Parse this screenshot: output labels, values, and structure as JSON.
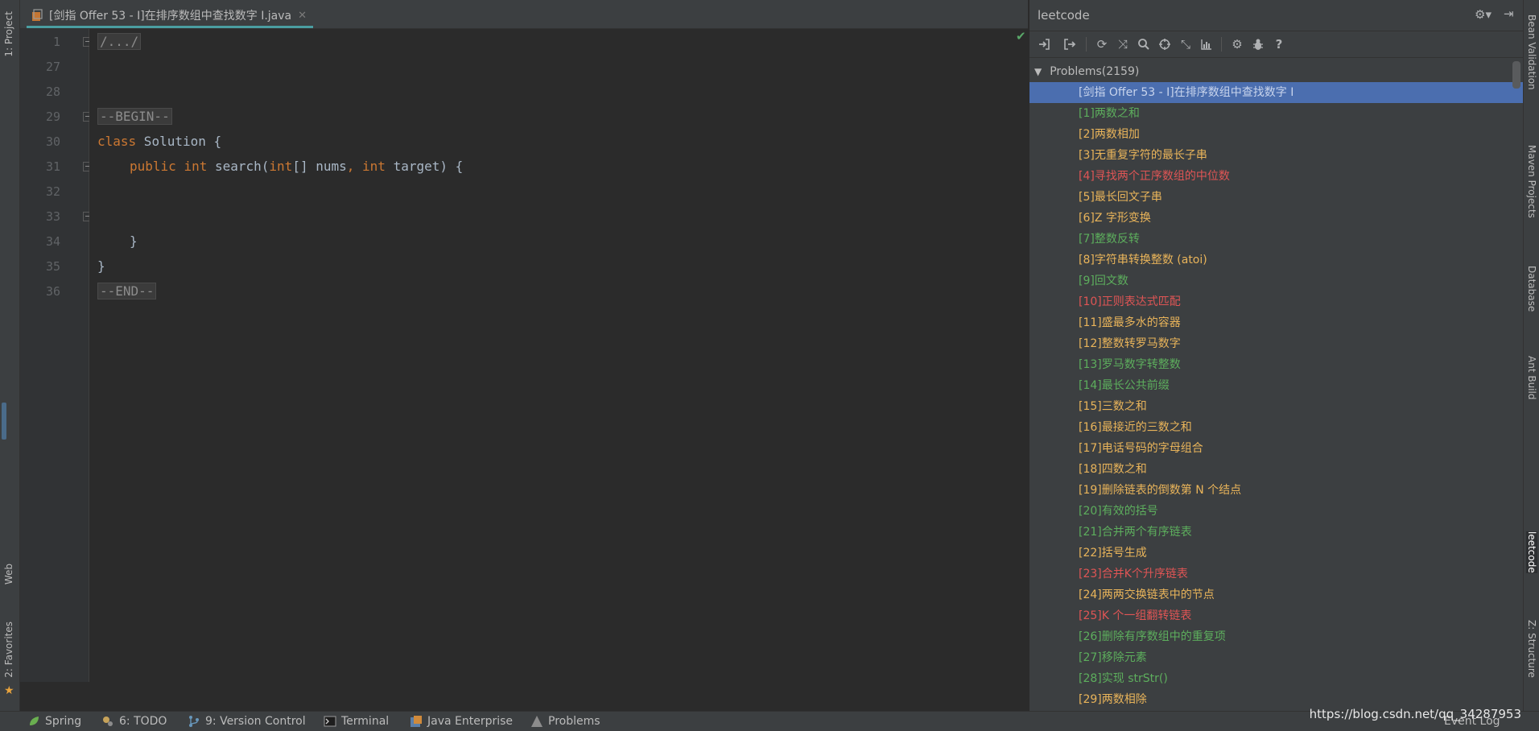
{
  "left_strip": {
    "project_label": "1: Project",
    "web_label": "Web",
    "favorites_label": "2: Favorites"
  },
  "editor": {
    "tab_title": "[剑指 Offer 53 - I]在排序数组中查找数字 I.java",
    "line_numbers": [
      "1",
      "27",
      "28",
      "29",
      "30",
      "31",
      "32",
      "33",
      "34",
      "35",
      "36"
    ],
    "code": {
      "folded_header": "/.../",
      "begin_marker": "--BEGIN--",
      "class_kw": "class",
      "class_rest": " Solution {",
      "public_kw": "public",
      "int_kw": "int",
      "method_name": " search(",
      "param1_type": "int",
      "param1_rest": "[] nums",
      "comma": ",",
      "param2_type": "int",
      "param2_rest": " target) {",
      "close_method": "}",
      "close_class": "}",
      "end_marker": "--END--"
    }
  },
  "leetcode_panel": {
    "title": "leetcode",
    "toolbar_icons": [
      "sign-in-icon",
      "sign-out-icon",
      "refresh-icon",
      "shuffle-icon",
      "search-icon",
      "locate-icon",
      "collapse-icon",
      "chart-icon",
      "gear-icon",
      "bug-icon",
      "help-icon"
    ],
    "tree_root": "Problems(2159)",
    "problems": [
      {
        "label": "[剑指 Offer 53 - I]在排序数组中查找数字 I",
        "status": "selected"
      },
      {
        "label": "[1]两数之和",
        "status": "solved"
      },
      {
        "label": "[2]两数相加",
        "status": "todo"
      },
      {
        "label": "[3]无重复字符的最长子串",
        "status": "todo"
      },
      {
        "label": "[4]寻找两个正序数组的中位数",
        "status": "failed"
      },
      {
        "label": "[5]最长回文子串",
        "status": "todo"
      },
      {
        "label": "[6]Z 字形变换",
        "status": "todo"
      },
      {
        "label": "[7]整数反转",
        "status": "solved"
      },
      {
        "label": "[8]字符串转换整数 (atoi)",
        "status": "todo"
      },
      {
        "label": "[9]回文数",
        "status": "solved"
      },
      {
        "label": "[10]正则表达式匹配",
        "status": "failed"
      },
      {
        "label": "[11]盛最多水的容器",
        "status": "todo"
      },
      {
        "label": "[12]整数转罗马数字",
        "status": "todo"
      },
      {
        "label": "[13]罗马数字转整数",
        "status": "solved"
      },
      {
        "label": "[14]最长公共前缀",
        "status": "solved"
      },
      {
        "label": "[15]三数之和",
        "status": "todo"
      },
      {
        "label": "[16]最接近的三数之和",
        "status": "todo"
      },
      {
        "label": "[17]电话号码的字母组合",
        "status": "todo"
      },
      {
        "label": "[18]四数之和",
        "status": "todo"
      },
      {
        "label": "[19]删除链表的倒数第 N 个结点",
        "status": "todo"
      },
      {
        "label": "[20]有效的括号",
        "status": "solved"
      },
      {
        "label": "[21]合并两个有序链表",
        "status": "solved"
      },
      {
        "label": "[22]括号生成",
        "status": "todo"
      },
      {
        "label": "[23]合并K个升序链表",
        "status": "failed"
      },
      {
        "label": "[24]两两交换链表中的节点",
        "status": "todo"
      },
      {
        "label": "[25]K 个一组翻转链表",
        "status": "failed"
      },
      {
        "label": "[26]删除有序数组中的重复项",
        "status": "solved"
      },
      {
        "label": "[27]移除元素",
        "status": "solved"
      },
      {
        "label": "[28]实现 strStr()",
        "status": "solved"
      },
      {
        "label": "[29]两数相除",
        "status": "todo"
      }
    ]
  },
  "right_strip": {
    "bean_validation": "Bean Validation",
    "maven_projects": "Maven Projects",
    "database": "Database",
    "ant_build": "Ant Build",
    "leetcode": "leetcode",
    "structure": "Z: Structure"
  },
  "bottom_bar": {
    "spring": "Spring",
    "todo": "6: TODO",
    "version_control": "9: Version Control",
    "terminal": "Terminal",
    "java_enterprise": "Java Enterprise",
    "problems": "Problems",
    "event_log": "Event Log"
  },
  "watermark": "https://blog.csdn.net/qq_34287953",
  "colors": {
    "solved": "#5dae5d",
    "todo": "#e9b45a",
    "failed": "#e05555",
    "selection": "#4b6eaf",
    "keyword": "#cc7832"
  }
}
